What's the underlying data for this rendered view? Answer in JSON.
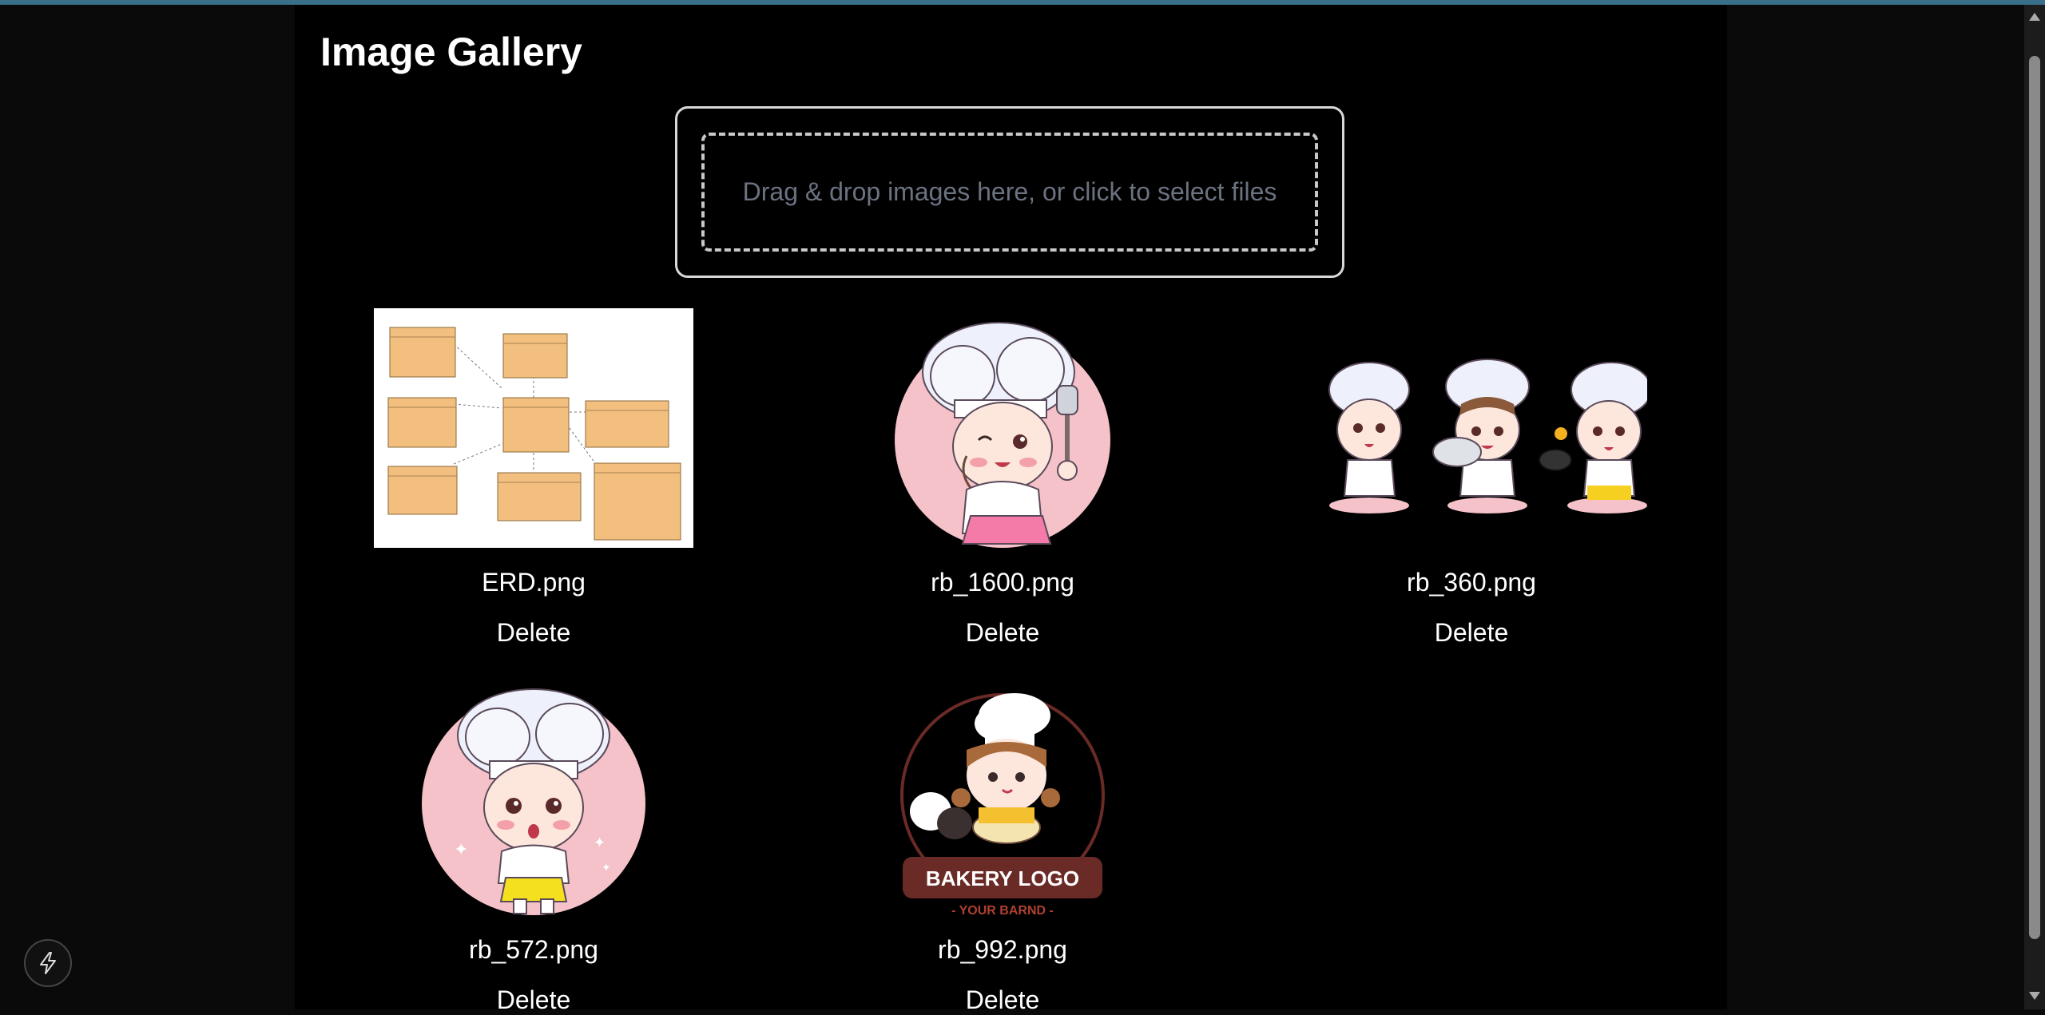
{
  "page": {
    "title": "Image Gallery"
  },
  "dropzone": {
    "text": "Drag & drop images here, or click to select files"
  },
  "images": [
    {
      "filename": "ERD.png",
      "delete_label": "Delete",
      "kind": "erd-diagram"
    },
    {
      "filename": "rb_1600.png",
      "delete_label": "Delete",
      "kind": "chef-girl-circle"
    },
    {
      "filename": "rb_360.png",
      "delete_label": "Delete",
      "kind": "three-chefs"
    },
    {
      "filename": "rb_572.png",
      "delete_label": "Delete",
      "kind": "chef-girl-circle"
    },
    {
      "filename": "rb_992.png",
      "delete_label": "Delete",
      "kind": "bakery-logo",
      "logo_text": "BAKERY LOGO",
      "logo_subtext": "- YOUR BARND -"
    }
  ],
  "colors": {
    "background": "#000000",
    "accent_bar": "#3a6f8a",
    "dropzone_text": "#6b7280",
    "pink": "#f4c2c8"
  },
  "icons": {
    "bottom_left_button": "lightning-icon"
  }
}
